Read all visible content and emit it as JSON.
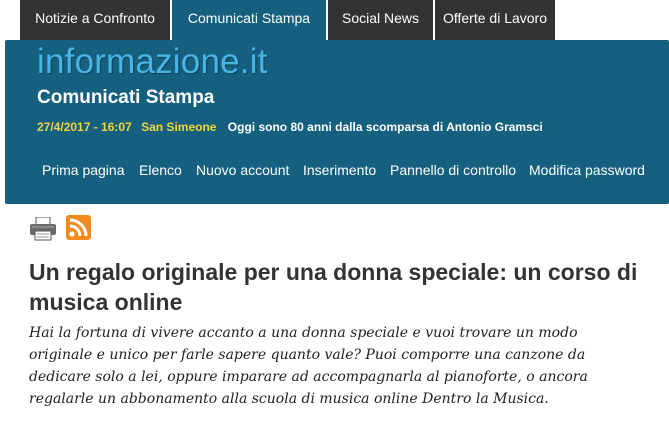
{
  "top_tabs": [
    {
      "label": "Notizie a Confronto",
      "active": false
    },
    {
      "label": "Comunicati Stampa",
      "active": true
    },
    {
      "label": "Social News",
      "active": false
    },
    {
      "label": "Offerte di Lavoro",
      "active": false
    }
  ],
  "header": {
    "logo": "informazione.it",
    "subtitle": "Comunicati Stampa",
    "date": "27/4/2017 - 16:07",
    "saint": "San Simeone",
    "anniversary_text": "Oggi sono 80 anni dalla scomparsa di",
    "anniversary_name": "Antonio Gramsci"
  },
  "main_nav": [
    {
      "label": "Prima pagina"
    },
    {
      "label": "Elenco"
    },
    {
      "label": "Nuovo account"
    },
    {
      "label": "Inserimento"
    },
    {
      "label": "Pannello di controllo"
    },
    {
      "label": "Modifica password"
    }
  ],
  "toolbar": {
    "print_icon": "printer-icon",
    "rss_icon": "rss-icon"
  },
  "article": {
    "title": "Un regalo originale per una donna speciale: un corso di musica online",
    "lead": "Hai la fortuna di vivere accanto a una donna speciale e vuoi trovare un modo originale e unico per farle sapere quanto vale? Puoi comporre una canzone da dedicare solo a lei, oppure imparare ad accompagnarla al pianoforte, o ancora regalarle un abbonamento alla scuola di musica online Dentro la Musica."
  },
  "colors": {
    "header_bg": "#15607f",
    "topnav_bg": "#333333",
    "logo": "#49b4e6",
    "accent_yellow": "#f0d53c"
  }
}
